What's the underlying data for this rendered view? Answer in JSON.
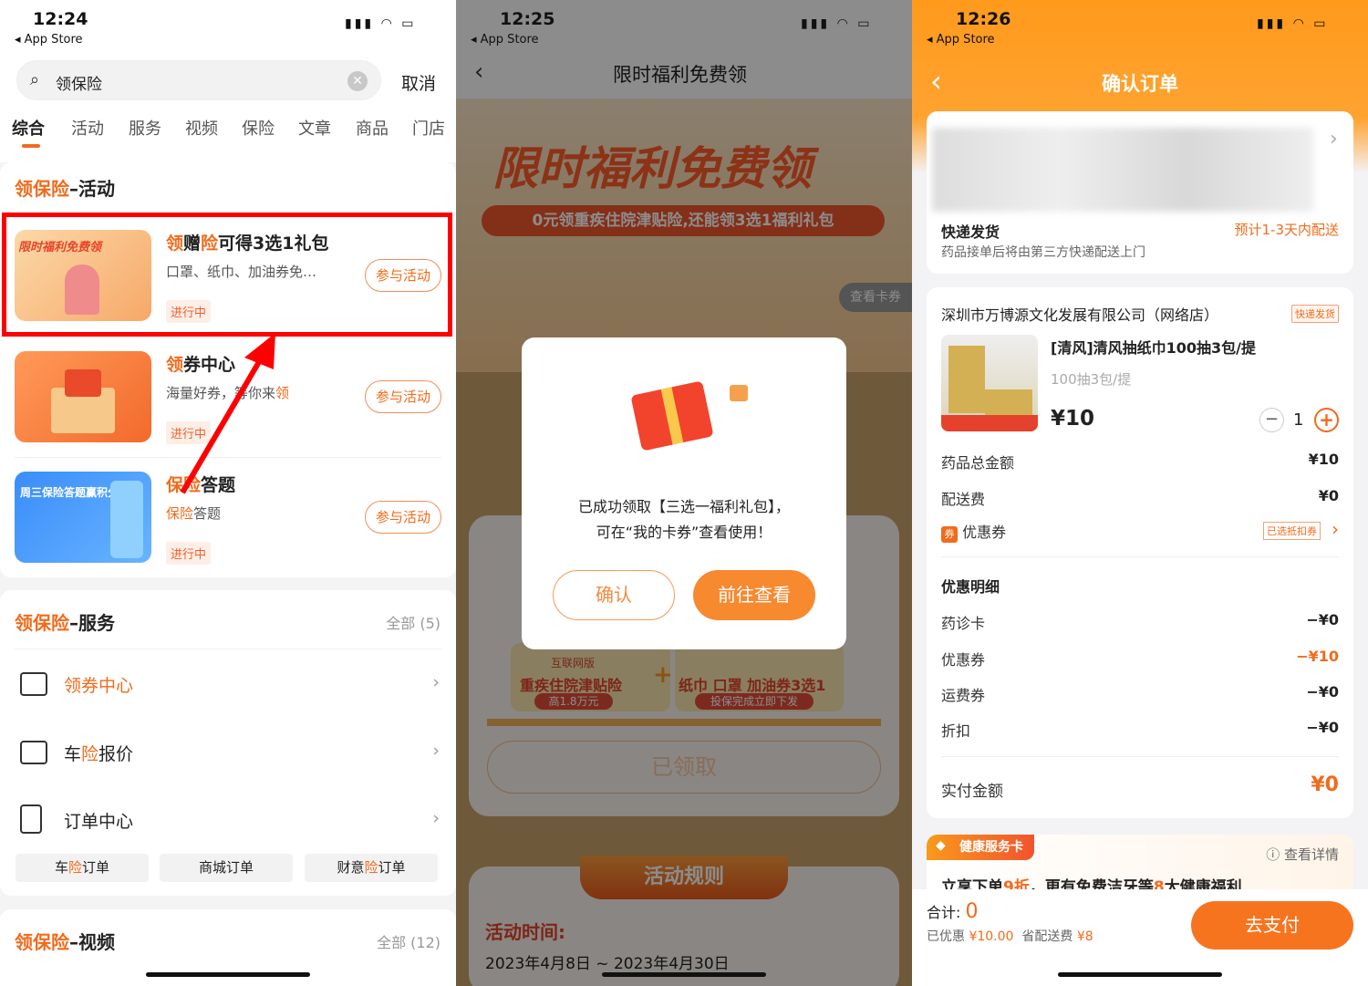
{
  "colors": {
    "accent": "#f26a1b",
    "header_orange": "#ff9c1c",
    "highlight_red": "#ff0000"
  },
  "screen1": {
    "status": {
      "time": "12:24",
      "back": "◂ App Store"
    },
    "search": {
      "value": "领保险",
      "cancel": "取消"
    },
    "tabs": [
      "综合",
      "活动",
      "服务",
      "视频",
      "保险",
      "文章",
      "商品",
      "门店"
    ],
    "activity_section": {
      "title_a": "领保险",
      "title_b": "–活动",
      "items": [
        {
          "t1": "领",
          "t2": "赠",
          "t3": "险",
          "t4": "可得3选1礼包",
          "sub": "口罩、纸巾、加油券免…",
          "tag": "进行中",
          "btn": "参与活动",
          "img_text": "限时福利免费领"
        },
        {
          "t1": "领",
          "t2": "券中心",
          "sub_a": "海量好券，等你来",
          "sub_b": "领",
          "tag": "进行中",
          "btn": "参与活动"
        },
        {
          "t1": "保险",
          "t2": "答题",
          "sub_a": "保险",
          "sub_b": "答题",
          "tag": "进行中",
          "btn": "参与活动",
          "img_text": "周三保险答题赢积分"
        }
      ]
    },
    "service_section": {
      "title_a": "领保险",
      "title_b": "–服务",
      "all": "全部 (5)",
      "items": [
        {
          "a": "领券中心",
          "b": "",
          "c": ""
        },
        {
          "a": "车",
          "b": "险",
          "c": "报价"
        },
        {
          "a": "订单中心",
          "b": "",
          "c": ""
        }
      ],
      "sub_buttons": [
        {
          "a": "车",
          "b": "险",
          "c": "订单"
        },
        {
          "a": "商城订单",
          "b": "",
          "c": ""
        },
        {
          "a": "财意",
          "b": "险",
          "c": "订单"
        }
      ]
    },
    "video_section": {
      "title_a": "领保险",
      "title_b": "–视频",
      "all": "全部 (12)"
    }
  },
  "screen2": {
    "status": {
      "time": "12:25",
      "back": "◂ App Store"
    },
    "title": "限时福利免费领",
    "banner_title": "限时福利免费领",
    "banner_sub": "0元领重疾住院津贴险,还能领3选1福利礼包",
    "view_cards": "查看卡券",
    "modal": {
      "line1": "已成功领取【三选一福利礼包】，",
      "line2": "可在“我的卡券”查看使用！",
      "confirm": "确认",
      "go": "前往查看"
    },
    "gift_left": {
      "badge": "互联网版",
      "name": "重疾住院津贴险",
      "pill": "高1.8万元"
    },
    "gift_right": {
      "name": "纸巾 口罩 加油券3选1",
      "pill": "投保完成立即下发"
    },
    "claimed": "已领取",
    "rules_title": "活动规则",
    "time_label": "活动时间:",
    "time_value": "2023年4月8日 ~ 2023年4月30日"
  },
  "screen3": {
    "status": {
      "time": "12:26",
      "back": "◂ App Store"
    },
    "title": "确认订单",
    "delivery": {
      "label": "快递发货",
      "eta": "预计1-3天内配送",
      "desc": "药品接单后将由第三方快递配送上门"
    },
    "shop": {
      "name": "深圳市万博源文化发展有限公司（网络店）",
      "badge": "快递发货"
    },
    "product": {
      "title": "[清风]清风抽纸巾100抽3包/提",
      "spec": "100抽3包/提",
      "price": "¥10",
      "qty": "1"
    },
    "rows": [
      {
        "label": "药品总金额",
        "value": "¥10"
      },
      {
        "label": "配送费",
        "value": "¥0"
      }
    ],
    "coupon": {
      "icon": "券",
      "label": "优惠券",
      "tag": "已选抵扣券"
    },
    "discount_title": "优惠明细",
    "discounts": [
      {
        "label": "药诊卡",
        "value": "−¥0"
      },
      {
        "label": "优惠券",
        "value": "−¥10"
      },
      {
        "label": "运费券",
        "value": "−¥0"
      },
      {
        "label": "折扣",
        "value": "−¥0"
      }
    ],
    "paid": {
      "label": "实付金额",
      "value": "¥0"
    },
    "health_card": {
      "badge": "健康服务卡",
      "details": "查看详情",
      "t1": "立享下单",
      "t2": "9折",
      "t3": "，更有免费洁牙等",
      "t4": "8",
      "t5": "大健康福利"
    },
    "footer": {
      "total_label": "合计:",
      "total": "0",
      "saved_label": "已优惠",
      "saved": "¥10.00",
      "ship_label": "省配送费",
      "ship": "¥8",
      "pay": "去支付"
    }
  }
}
